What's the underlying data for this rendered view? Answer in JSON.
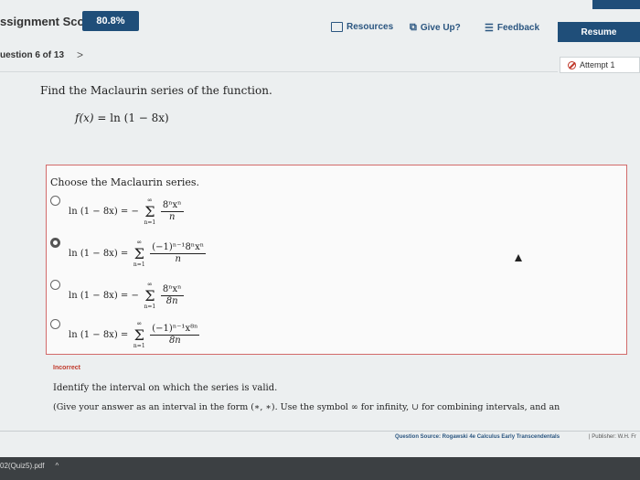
{
  "header": {
    "score_label": "ssignment Score:",
    "score_value": "80.8%",
    "resources": "Resources",
    "give_up": "Give Up?",
    "feedback": "Feedback",
    "resume": "Resume"
  },
  "nav": {
    "question": "uestion 6 of 13",
    "next": ">",
    "attempt": "Attempt 1"
  },
  "question": {
    "prompt": "Find the Maclaurin series of the function.",
    "function_lhs": "f(x)",
    "function_rhs": " = ln (1 − 8x)",
    "choose": "Choose the Maclaurin series.",
    "options": [
      {
        "lhs": "ln (1 − 8x) = −",
        "num": "8ⁿxⁿ",
        "den": "n",
        "upper": "∞",
        "lower": "n=1",
        "selected": false
      },
      {
        "lhs": "ln (1 − 8x) =",
        "num": "(−1)ⁿ⁻¹8ⁿxⁿ",
        "den": "n",
        "upper": "∞",
        "lower": "n=1",
        "selected": true
      },
      {
        "lhs": "ln (1 − 8x) = −",
        "num": "8ⁿxⁿ",
        "den": "8n",
        "upper": "∞",
        "lower": "n=1",
        "selected": false
      },
      {
        "lhs": "ln (1 − 8x) =",
        "num": "(−1)ⁿ⁻¹x⁸ⁿ",
        "den": "8n",
        "upper": "∞",
        "lower": "n=1",
        "selected": false
      }
    ],
    "status": "Incorrect",
    "identify": "Identify the interval on which the series is valid.",
    "give": "(Give your answer as an interval in the form (∗, ∗). Use the symbol ∞ for infinity, ∪ for combining intervals, and an"
  },
  "footer": {
    "source": "Question Source: Rogawski 4e Calculus Early Transcendentals",
    "publisher": "| Publisher: W.H. Fr"
  },
  "taskbar": {
    "download": "02(Quiz5).pdf",
    "caret": "^"
  },
  "colors": {
    "accent": "#1f4e79",
    "error": "#c0392b"
  }
}
